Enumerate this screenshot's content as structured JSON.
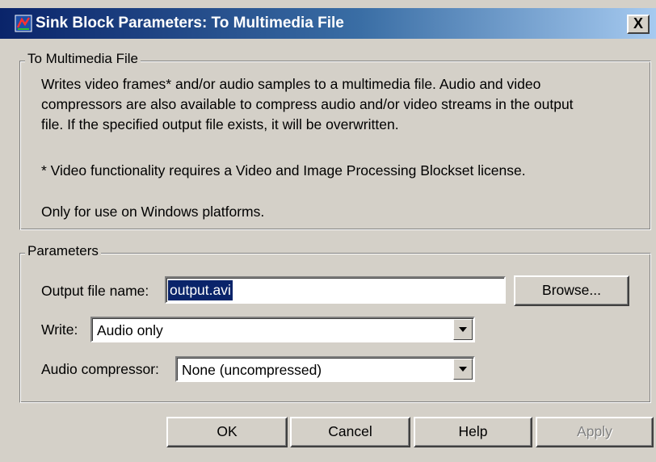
{
  "window": {
    "title": "Sink Block Parameters: To Multimedia File",
    "close_label": "X"
  },
  "description_group": {
    "legend": "To Multimedia File",
    "lines": [
      "Writes video frames* and/or audio samples to a multimedia file.  Audio and video",
      "compressors are also available to compress audio and/or video streams in the output",
      "file.  If the specified output file exists, it will be overwritten.",
      "* Video functionality requires a Video and Image Processing Blockset license.",
      "Only for use on Windows platforms."
    ]
  },
  "parameters_group": {
    "legend": "Parameters",
    "output_file": {
      "label": "Output file name:",
      "value": "output.avi",
      "browse_label": "Browse..."
    },
    "write": {
      "label": "Write:",
      "value": "Audio only"
    },
    "audio_compressor": {
      "label": "Audio compressor:",
      "value": "None (uncompressed)"
    }
  },
  "buttons": {
    "ok": "OK",
    "cancel": "Cancel",
    "help": "Help",
    "apply": "Apply"
  },
  "colors": {
    "title_bar_start": "#0a246a",
    "title_bar_end": "#a6caf0",
    "dialog_face": "#d4d0c8",
    "selection": "#0a246a"
  },
  "icons": {
    "title_icon": "simulink-block-icon",
    "close_icon": "close-icon",
    "dropdown_icon": "chevron-down-icon"
  }
}
